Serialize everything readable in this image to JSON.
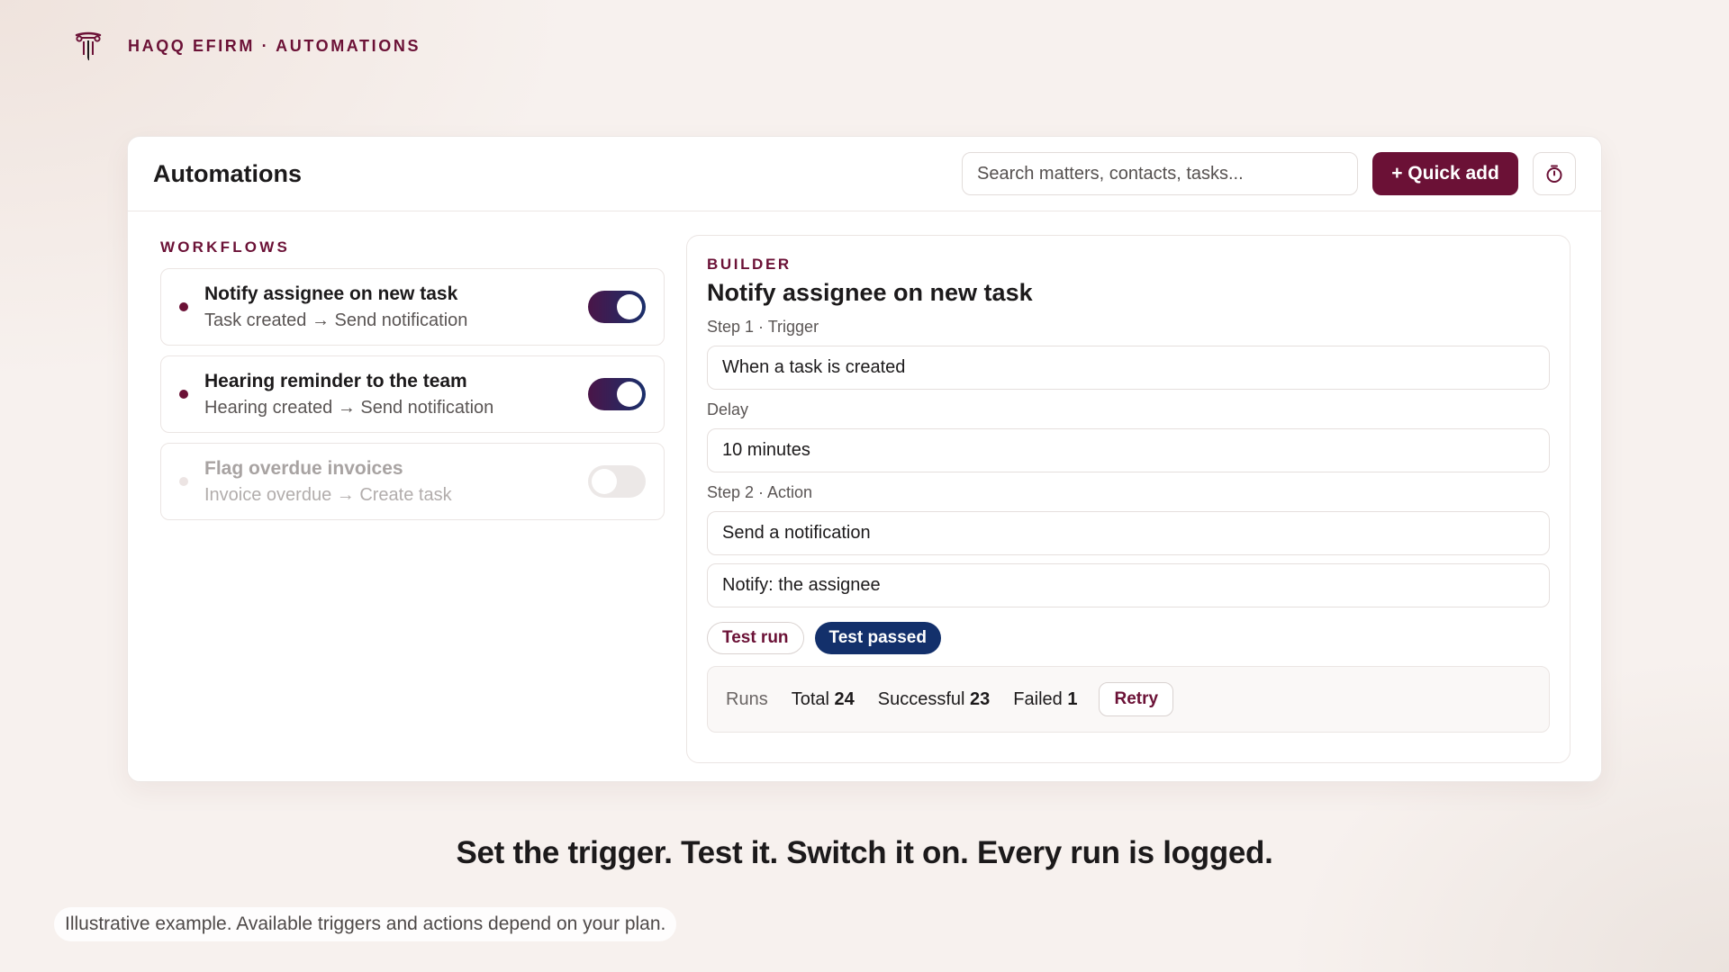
{
  "brand": {
    "name": "HAQQ EFIRM · AUTOMATIONS",
    "accent": "#6b1136"
  },
  "header": {
    "title": "Automations",
    "search_placeholder": "Search matters, contacts, tasks...",
    "quick_add_label": "+ Quick add",
    "timer_icon": "stopwatch-icon"
  },
  "workflows": {
    "section_label": "WORKFLOWS",
    "items": [
      {
        "title": "Notify assignee on new task",
        "subtitle": "Task created → Send notification",
        "enabled": true
      },
      {
        "title": "Hearing reminder to the team",
        "subtitle": "Hearing created → Send notification",
        "enabled": true
      },
      {
        "title": "Flag overdue invoices",
        "subtitle": "Invoice overdue → Create task",
        "enabled": false
      }
    ]
  },
  "builder": {
    "section_label": "BUILDER",
    "title": "Notify assignee on new task",
    "step1_label": "Step 1 · Trigger",
    "trigger_value": "When a task is created",
    "delay_label": "Delay",
    "delay_value": "10 minutes",
    "step2_label": "Step 2 · Action",
    "action_value": "Send a notification",
    "notify_value": "Notify: the assignee",
    "test_run_label": "Test run",
    "test_status": "Test passed",
    "runs": {
      "label": "Runs",
      "total_label": "Total",
      "total": "24",
      "success_label": "Successful",
      "success": "23",
      "failed_label": "Failed",
      "failed": "1",
      "retry_label": "Retry"
    }
  },
  "tagline": "Set the trigger. Test it. Switch it on. Every run is logged.",
  "disclaimer": "Illustrative example. Available triggers and actions depend on your plan."
}
